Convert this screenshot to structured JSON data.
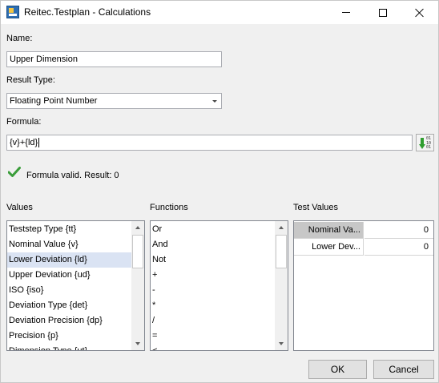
{
  "window": {
    "title": "Reitec.Testplan - Calculations"
  },
  "name": {
    "label": "Name:",
    "value": "Upper Dimension"
  },
  "result_type": {
    "label": "Result Type:",
    "selected": "Floating Point Number"
  },
  "formula": {
    "label": "Formula:",
    "value": "{v}+{ld}",
    "insert_icon_digits": "01\n10\n01"
  },
  "validation": {
    "message": "Formula valid. Result: 0",
    "color": "#3a9d3a"
  },
  "values": {
    "label": "Values",
    "items": [
      "Teststep Type {tt}",
      "Nominal Value {v}",
      "Lower Deviation {ld}",
      "Upper Deviation {ud}",
      "ISO {iso}",
      "Deviation Type {det}",
      "Deviation Precision {dp}",
      "Precision {p}",
      "Dimension Type {ut}"
    ],
    "selected_index": 2
  },
  "functions": {
    "label": "Functions",
    "items": [
      "Or",
      "And",
      "Not",
      "+",
      "-",
      "*",
      "/",
      "=",
      "<"
    ]
  },
  "test_values": {
    "label": "Test Values",
    "rows": [
      {
        "name": "Nominal Va...",
        "value": "0"
      },
      {
        "name": "Lower Dev...",
        "value": "0"
      }
    ]
  },
  "buttons": {
    "ok": "OK",
    "cancel": "Cancel"
  }
}
